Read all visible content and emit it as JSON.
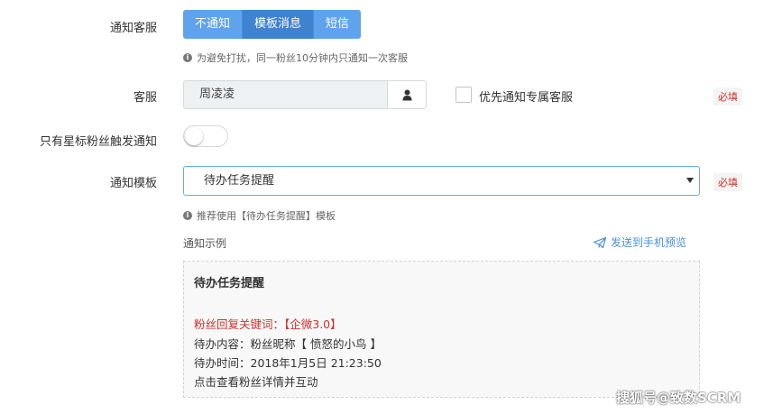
{
  "notify_cs": {
    "label": "通知客服",
    "options": [
      "不通知",
      "模板消息",
      "短信"
    ],
    "selected": "模板消息",
    "hint": "为避免打扰，同一粉丝10分钟内只通知一次客服"
  },
  "cs": {
    "label": "客服",
    "value": "周凌凌",
    "icon": "user-icon",
    "checkbox_label": "优先通知专属客服",
    "checked": false,
    "required": "必填"
  },
  "star_only": {
    "label": "只有星标粉丝触发通知",
    "enabled": false
  },
  "template": {
    "label": "通知模板",
    "selected": "待办任务提醒",
    "required": "必填",
    "hint": "推荐使用【待办任务提醒】模板"
  },
  "preview": {
    "title": "通知示例",
    "send_link": "发送到手机预览",
    "heading": "待办任务提醒",
    "keyword_line": "粉丝回复关键词：【企微3.0】",
    "content_line": "待办内容：粉丝昵称【 愤怒的小鸟 】",
    "time_line": "待办时间：2018年1月5日 21:23:50",
    "action_line": "点击查看粉丝详情并互动"
  },
  "watermark": "搜狐号@致数SCRM",
  "colors": {
    "primary": "#5fa3ec",
    "primary_active": "#3f82d0",
    "required_red": "#c9302c",
    "link_blue": "#4a90d9"
  }
}
